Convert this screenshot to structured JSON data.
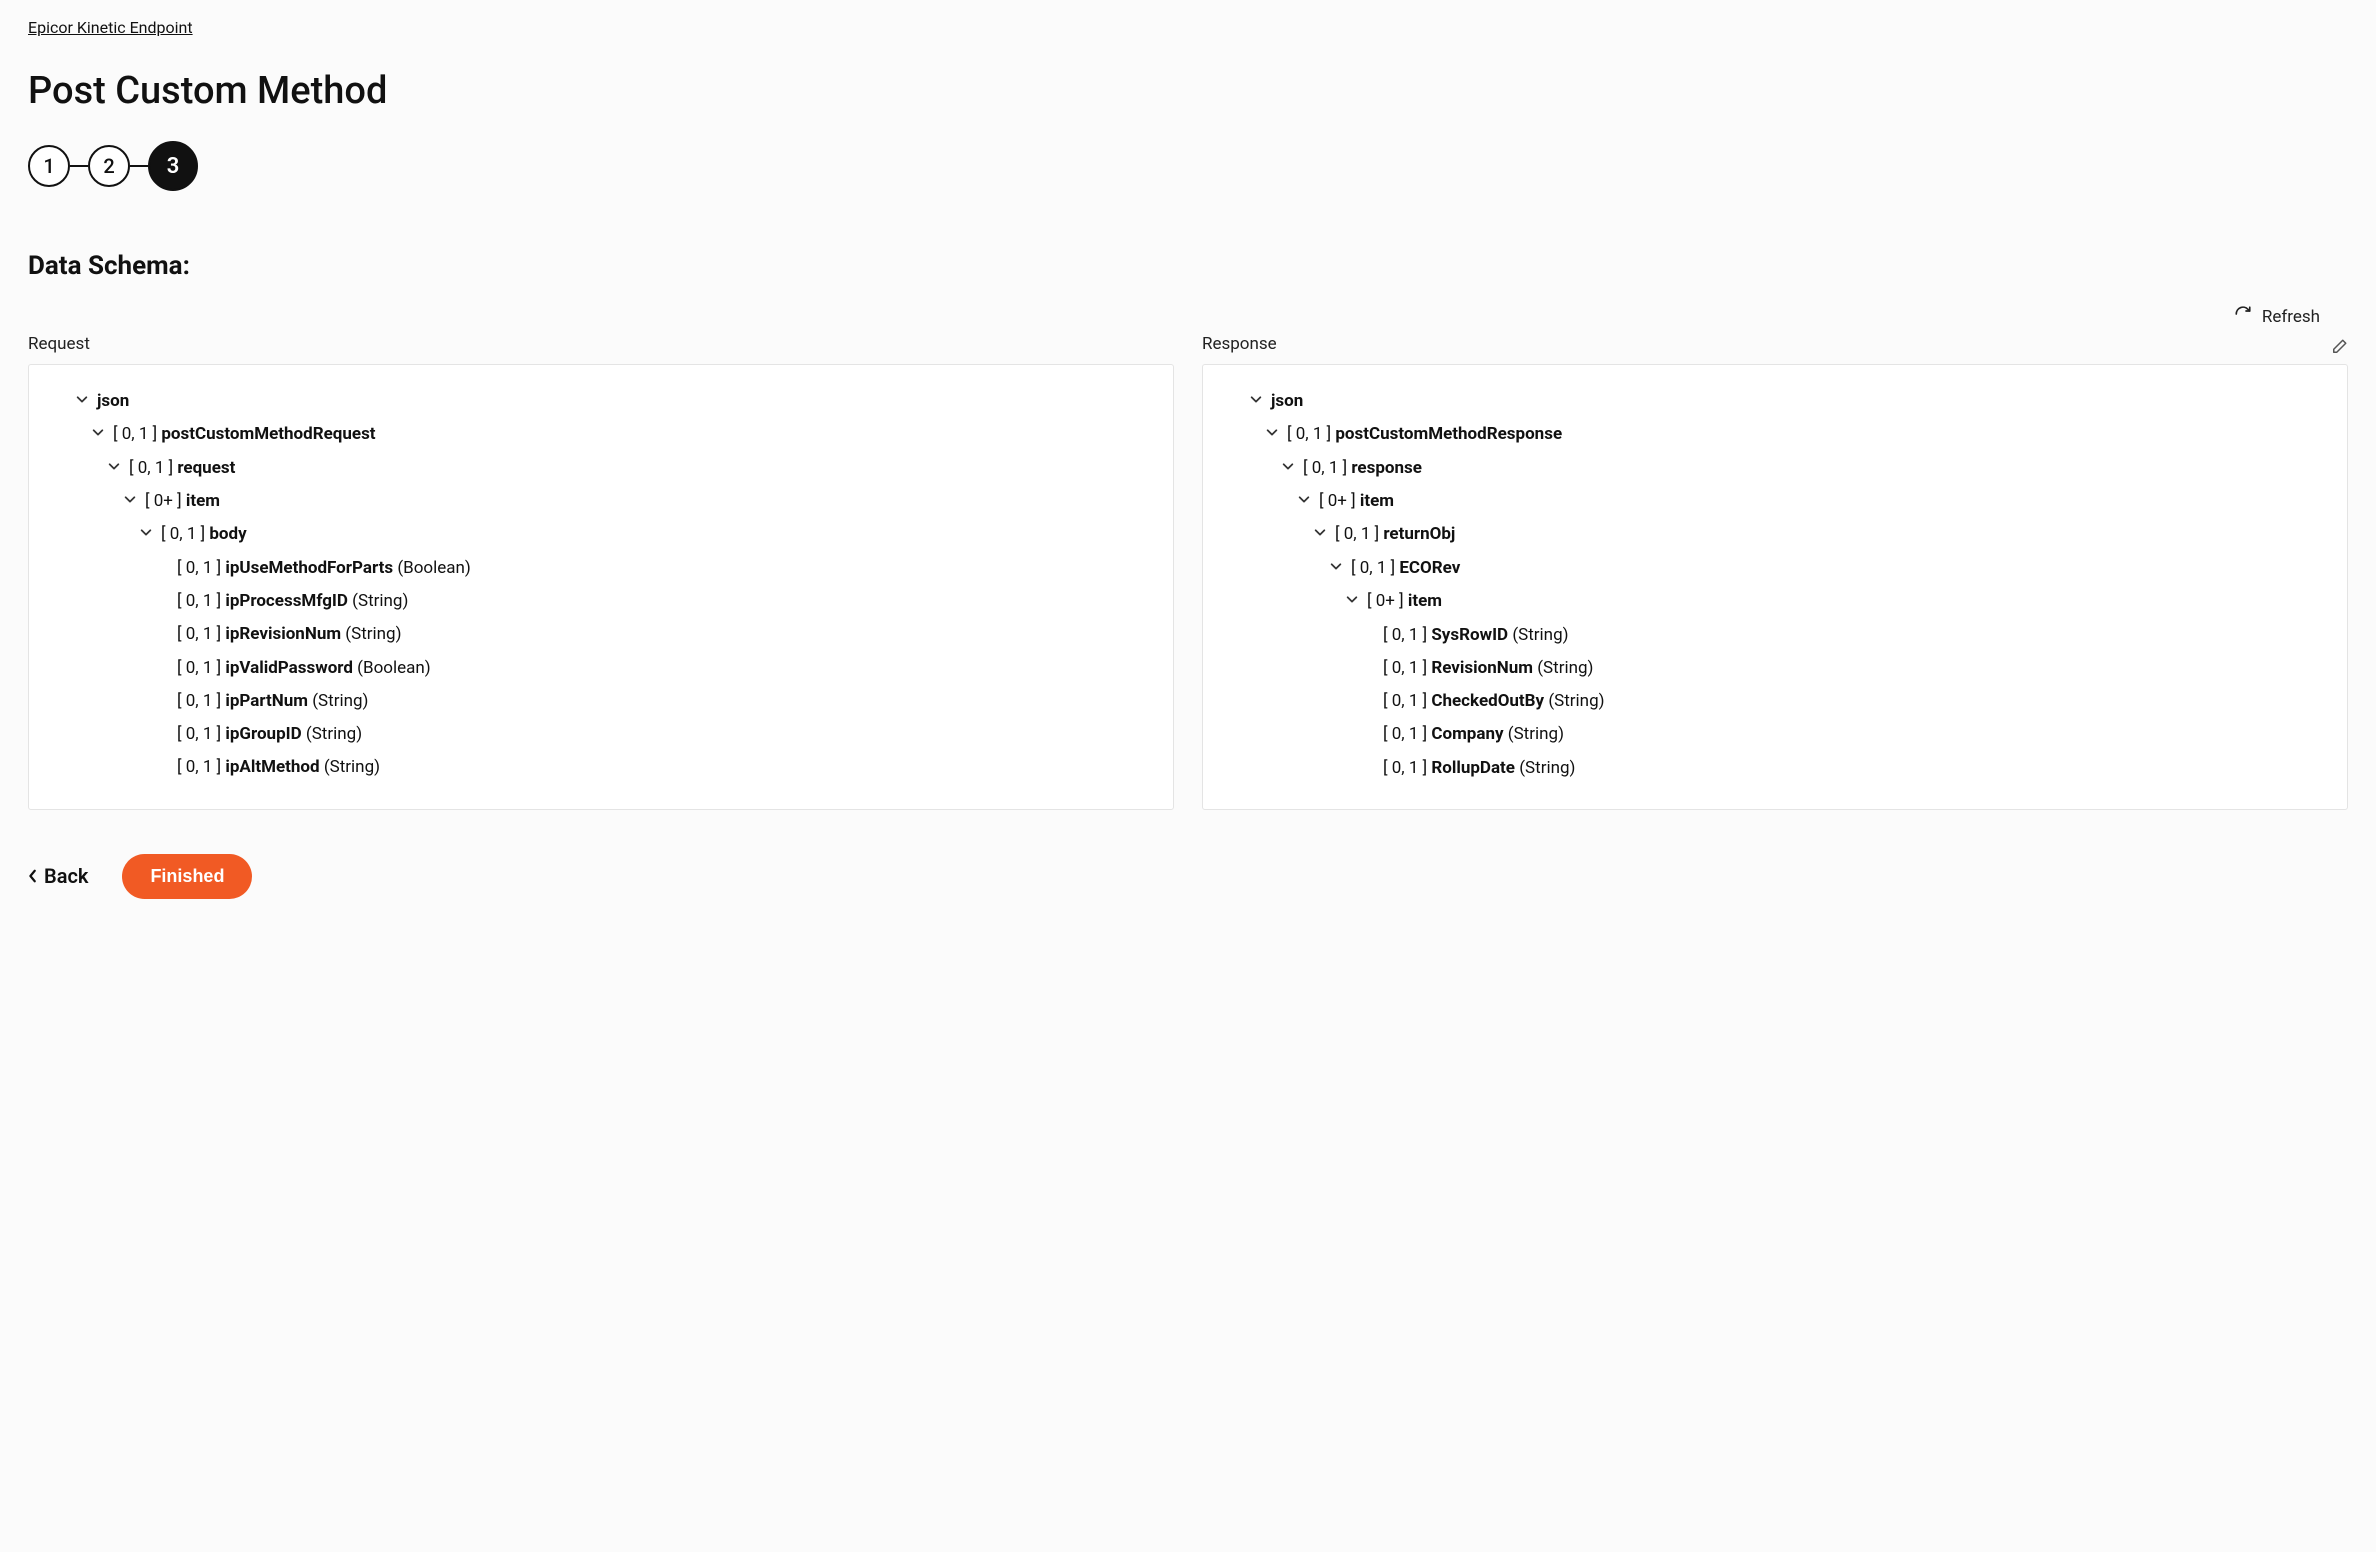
{
  "breadcrumb": "Epicor Kinetic Endpoint",
  "page_title": "Post Custom Method",
  "stepper": {
    "steps": [
      "1",
      "2",
      "3"
    ],
    "active_index": 2
  },
  "section_title": "Data Schema:",
  "toolbar": {
    "refresh_label": "Refresh"
  },
  "panels": {
    "request": {
      "label": "Request",
      "tree": [
        {
          "indent": 0,
          "expandable": true,
          "name": "json"
        },
        {
          "indent": 1,
          "expandable": true,
          "cardinality": "[ 0, 1 ]",
          "name": "postCustomMethodRequest"
        },
        {
          "indent": 2,
          "expandable": true,
          "cardinality": "[ 0, 1 ]",
          "name": "request"
        },
        {
          "indent": 3,
          "expandable": true,
          "cardinality": "[ 0+ ]",
          "name": "item"
        },
        {
          "indent": 4,
          "expandable": true,
          "cardinality": "[ 0, 1 ]",
          "name": "body"
        },
        {
          "indent": 5,
          "expandable": false,
          "cardinality": "[ 0, 1 ]",
          "name": "ipUseMethodForParts",
          "type": "(Boolean)"
        },
        {
          "indent": 5,
          "expandable": false,
          "cardinality": "[ 0, 1 ]",
          "name": "ipProcessMfgID",
          "type": "(String)"
        },
        {
          "indent": 5,
          "expandable": false,
          "cardinality": "[ 0, 1 ]",
          "name": "ipRevisionNum",
          "type": "(String)"
        },
        {
          "indent": 5,
          "expandable": false,
          "cardinality": "[ 0, 1 ]",
          "name": "ipValidPassword",
          "type": "(Boolean)"
        },
        {
          "indent": 5,
          "expandable": false,
          "cardinality": "[ 0, 1 ]",
          "name": "ipPartNum",
          "type": "(String)"
        },
        {
          "indent": 5,
          "expandable": false,
          "cardinality": "[ 0, 1 ]",
          "name": "ipGroupID",
          "type": "(String)"
        },
        {
          "indent": 5,
          "expandable": false,
          "cardinality": "[ 0, 1 ]",
          "name": "ipAltMethod",
          "type": "(String)"
        }
      ]
    },
    "response": {
      "label": "Response",
      "tree": [
        {
          "indent": 0,
          "expandable": true,
          "name": "json"
        },
        {
          "indent": 1,
          "expandable": true,
          "cardinality": "[ 0, 1 ]",
          "name": "postCustomMethodResponse"
        },
        {
          "indent": 2,
          "expandable": true,
          "cardinality": "[ 0, 1 ]",
          "name": "response"
        },
        {
          "indent": 3,
          "expandable": true,
          "cardinality": "[ 0+ ]",
          "name": "item"
        },
        {
          "indent": 4,
          "expandable": true,
          "cardinality": "[ 0, 1 ]",
          "name": "returnObj"
        },
        {
          "indent": 5,
          "expandable": true,
          "cardinality": "[ 0, 1 ]",
          "name": "ECORev"
        },
        {
          "indent": 6,
          "expandable": true,
          "cardinality": "[ 0+ ]",
          "name": "item"
        },
        {
          "indent": 7,
          "expandable": false,
          "cardinality": "[ 0, 1 ]",
          "name": "SysRowID",
          "type": "(String)"
        },
        {
          "indent": 7,
          "expandable": false,
          "cardinality": "[ 0, 1 ]",
          "name": "RevisionNum",
          "type": "(String)"
        },
        {
          "indent": 7,
          "expandable": false,
          "cardinality": "[ 0, 1 ]",
          "name": "CheckedOutBy",
          "type": "(String)"
        },
        {
          "indent": 7,
          "expandable": false,
          "cardinality": "[ 0, 1 ]",
          "name": "Company",
          "type": "(String)"
        },
        {
          "indent": 7,
          "expandable": false,
          "cardinality": "[ 0, 1 ]",
          "name": "RollupDate",
          "type": "(String)"
        }
      ]
    }
  },
  "footer": {
    "back_label": "Back",
    "finished_label": "Finished"
  }
}
